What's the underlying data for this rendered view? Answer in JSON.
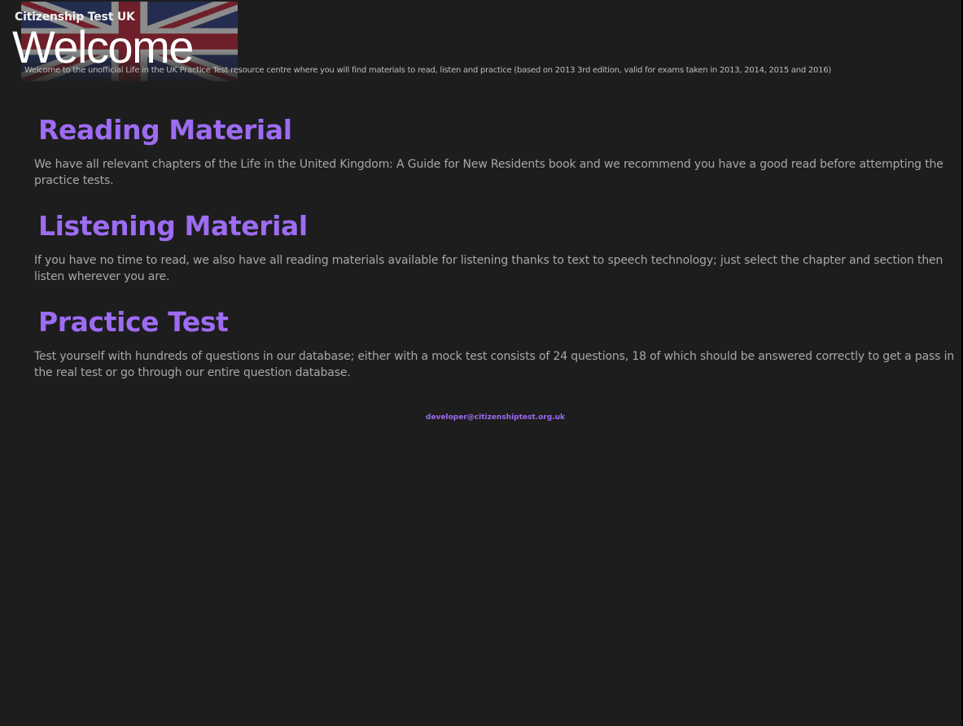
{
  "header": {
    "app_title": "Citizenship Test UK",
    "page_title": "Welcome",
    "subtitle": "Welcome to the unofficial Life in the UK Practice Test resource centre where you will find materials to read, listen and practice (based on 2013 3rd edition, valid for exams taken in 2013, 2014, 2015 and 2016)",
    "background_image": "union-jack-flag"
  },
  "sections": [
    {
      "title": "Reading Material",
      "body": "We have all relevant chapters of the Life in the United Kingdom: A Guide for New Residents book and we recommend you have a good read before attempting the practice tests."
    },
    {
      "title": "Listening Material",
      "body": "If you have no time to read, we also have all reading materials available for listening thanks to text to speech technology; just select the chapter and section then listen wherever you are."
    },
    {
      "title": "Practice Test",
      "body": "Test yourself with hundreds of questions in our database; either with a mock test consists of 24 questions, 18 of which should be answered correctly to get a pass in the real test or go through our entire question database."
    }
  ],
  "footer": {
    "email": "developer@citizenshiptest.org.uk"
  },
  "colors": {
    "background": "#1d1d1d",
    "accent": "#9d6cf2",
    "body_text": "#a8a8a8",
    "title_text": "#ffffff"
  }
}
